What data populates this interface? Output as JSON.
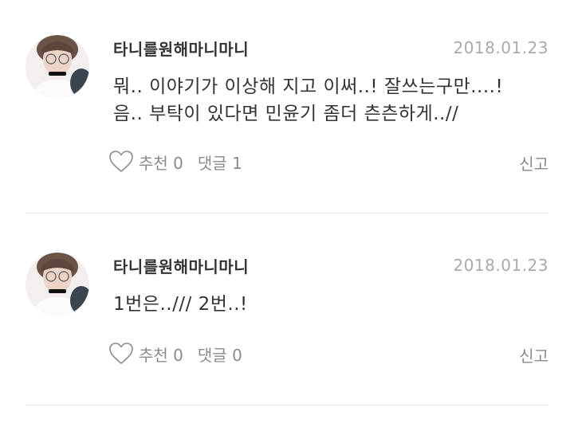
{
  "comments": [
    {
      "username": "타니를원해마니마니",
      "date": "2018.01.23",
      "text_line1": "뭐.. 이야기가 이상해 지고 이써..! 잘쓰는구만....!",
      "text_line2": "음.. 부탁이 있다면 민윤기 좀더 츤츤하게..//",
      "like_label": "추천",
      "like_count": "0",
      "reply_label": "댓글",
      "reply_count": "1",
      "report_label": "신고"
    },
    {
      "username": "타니를원해마니마니",
      "date": "2018.01.23",
      "text_line1": "1번은../// 2번..!",
      "like_label": "추천",
      "like_count": "0",
      "reply_label": "댓글",
      "reply_count": "0",
      "report_label": "신고"
    }
  ],
  "icons": {
    "like": "heart-outline-icon"
  },
  "colors": {
    "text": "#333333",
    "muted": "#8a8a8a",
    "date": "#aaaaaa",
    "divider": "#e6e6e6"
  }
}
